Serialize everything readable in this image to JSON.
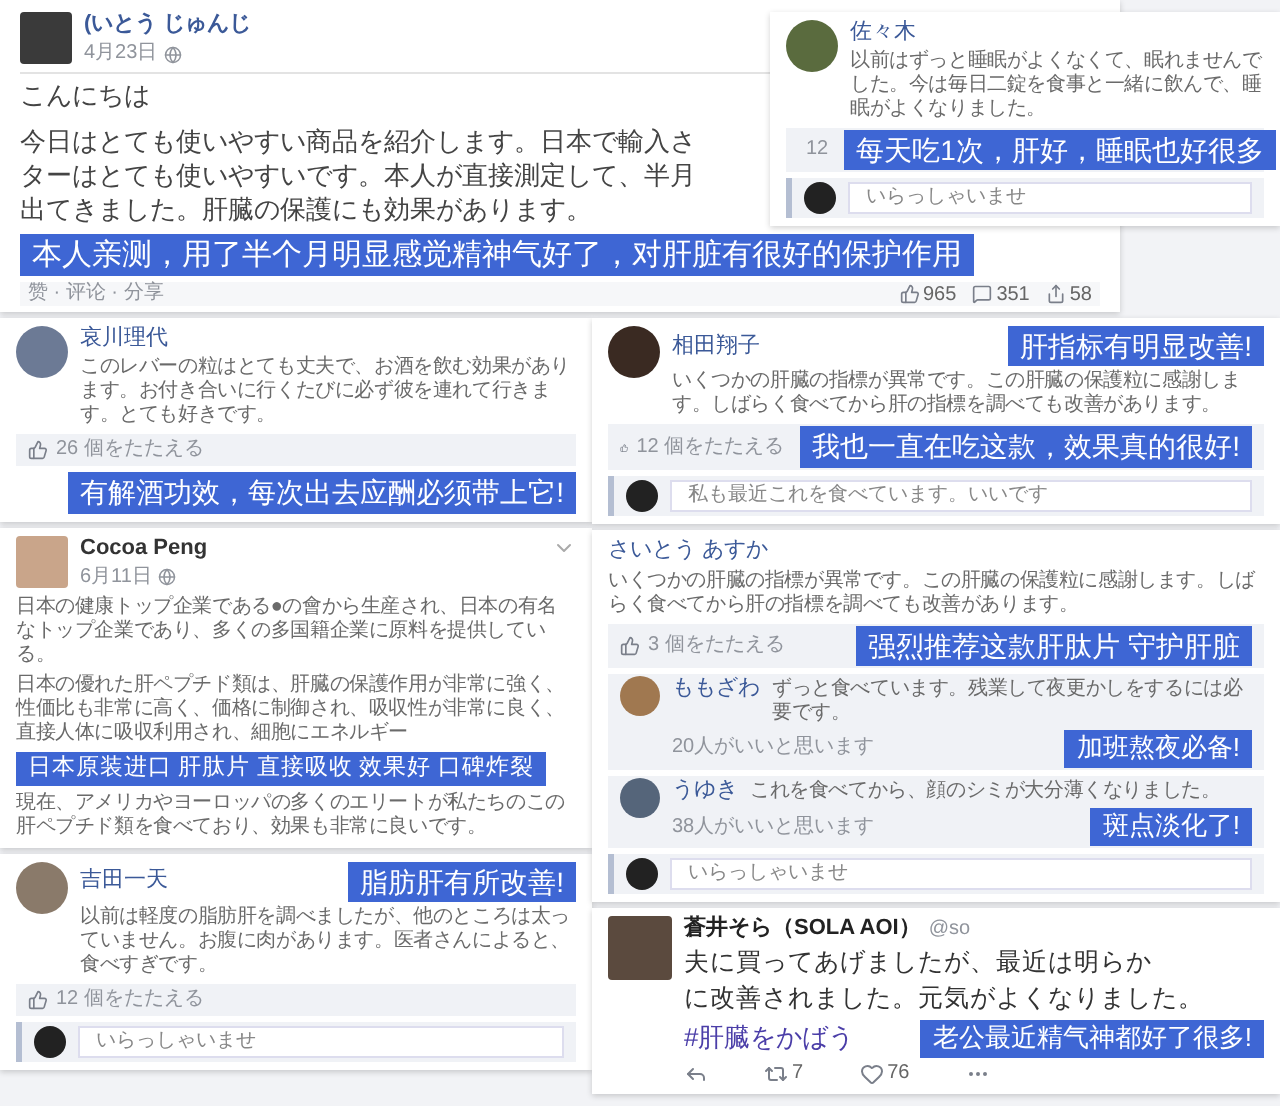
{
  "main_post": {
    "author": "(いとう じゅんじ",
    "date": "4月23日",
    "greeting": "こんにちは",
    "body_lines": [
      "今日はとても使いやすい商品を紹介します。日本で輸入さ",
      "ターはとても使いやすいです。本人が直接測定して、半月",
      "出てきました。肝臓の保護にも効果があります。"
    ],
    "caption": "本人亲测，用了半个月明显感觉精神气好了，对肝脏有很好的保护作用",
    "actions": "赞 · 评论 · 分享",
    "stats": [
      {
        "kind": "like",
        "count": "965"
      },
      {
        "kind": "comment",
        "count": "351"
      },
      {
        "kind": "share",
        "count": "58"
      }
    ]
  },
  "cards": [
    {
      "kind": "comment",
      "author": "佐々木",
      "text": "以前はずっと睡眠がよくなくて、眠れませんでした。今は毎日二錠を食事と一緒に飲んで、睡眠がよくなりました。",
      "likes": "12",
      "captions": [
        "每天吃1次，肝好，睡眠也好很多"
      ],
      "reply": "いらっしゃいませ"
    },
    {
      "kind": "comment",
      "author": "哀川理代",
      "text": "このレバーの粒はとても丈夫で、お酒を飲む効果があります。お付き合いに行くたびに必ず彼を連れて行きます。とても好きです。",
      "likes": "26 個をたたえる",
      "captions": [
        "有解酒功效，每次出去应酬必须带上它!"
      ]
    },
    {
      "kind": "comment",
      "author": "相田翔子",
      "text": "いくつかの肝臓の指標が異常です。この肝臓の保護粒に感謝します。しばらく食べてから肝の指標を調べても改善があります。",
      "likes": "12 個をたたえる",
      "captions": [
        "肝指标有明显改善!",
        "我也一直在吃这款，效果真的很好!"
      ],
      "reply": "私も最近これを食べています。いいです"
    },
    {
      "kind": "post",
      "author": "Cocoa Peng",
      "date": "6月11日",
      "paragraphs": [
        "日本の健康トップ企業である●の會から生産され、日本の有名なトップ企業であり、多くの多国籍企業に原料を提供している。",
        "日本の優れた肝ペプチド類は、肝臓の保護作用が非常に強く、性価比も非常に高く、価格に制御され、吸収性が非常に良く、直接人体に吸収利用され、細胞にエネルギー",
        "現在、アメリカやヨーロッパの多くのエリートが私たちのこの肝ペプチド類を食べており、効果も非常に良いです。"
      ],
      "captions": [
        "日本原装进口 肝肽片 直接吸收 效果好 口碑炸裂"
      ]
    },
    {
      "kind": "thread",
      "author": "さいとう あすか",
      "text": "いくつかの肝臓の指標が異常です。この肝臓の保護粒に感謝します。しばらく食べてから肝の指標を調べても改善があります。",
      "likes": "3 個をたたえる",
      "captions": [
        "强烈推荐这款肝肽片 守护肝脏"
      ],
      "replies": [
        {
          "author": "ももざわ",
          "text": "ずっと食べています。残業して夜更かしをするには必要です。",
          "likes": "20人がいいと思います",
          "caption": "加班熬夜必备!"
        },
        {
          "author": "うゆき",
          "text": "これを食べてから、顔のシミが大分薄くなりました。",
          "likes": "38人がいいと思います",
          "caption": "斑点淡化了!"
        }
      ],
      "reply": "いらっしゃいませ"
    },
    {
      "kind": "comment",
      "author": "吉田一天",
      "text": "以前は軽度の脂肪肝を調べましたが、他のところは太っていません。お腹に肉があります。医者さんによると、食べすぎです。",
      "likes": "12 個をたたえる",
      "captions": [
        "脂肪肝有所改善!"
      ],
      "reply": "いらっしゃいませ"
    },
    {
      "kind": "tweet",
      "author": "蒼井そら（SOLA AOI）",
      "handle": "@so",
      "captions": [
        "老公最近精气神都好了很多!"
      ],
      "text_lines": [
        "夫に買ってあげましたが、最近は明らか",
        "に改善されました。元気がよくなりました。"
      ],
      "hashtag": "#肝臓をかばう",
      "retweets": "7",
      "favorites": "76"
    }
  ]
}
